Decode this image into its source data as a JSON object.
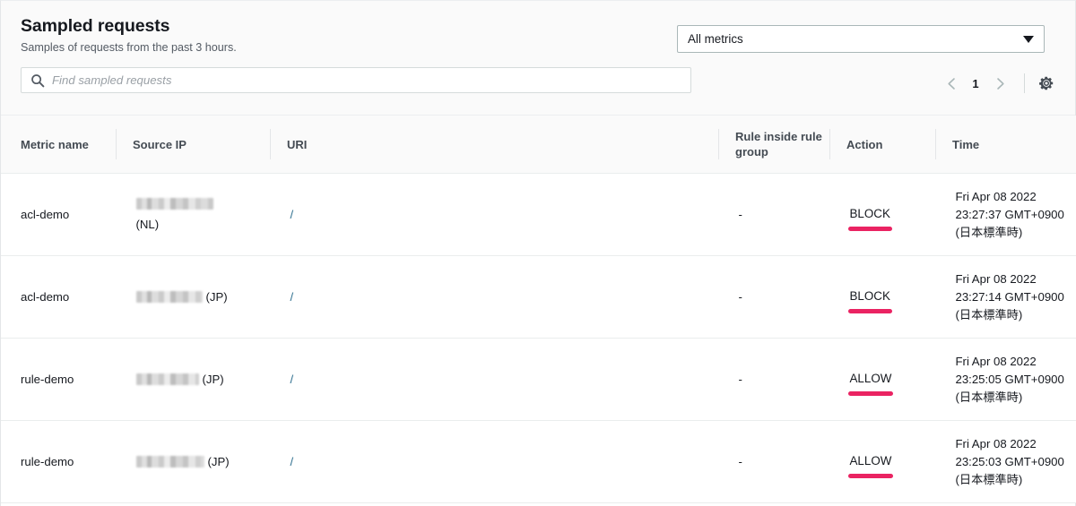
{
  "header": {
    "title": "Sampled requests",
    "subtitle": "Samples of requests from the past 3 hours."
  },
  "search": {
    "placeholder": "Find sampled requests",
    "value": "",
    "icon": "search-icon"
  },
  "metric_filter": {
    "selected": "All metrics",
    "icon": "chevron-down-icon"
  },
  "pagination": {
    "prev_icon": "chevron-left-icon",
    "next_icon": "chevron-right-icon",
    "current_page": "1"
  },
  "settings": {
    "icon": "gear-icon"
  },
  "table": {
    "columns": [
      {
        "label": "Metric name"
      },
      {
        "label": "Source IP"
      },
      {
        "label": "URI"
      },
      {
        "label": "Rule inside rule group"
      },
      {
        "label": "Action"
      },
      {
        "label": "Time"
      }
    ],
    "rows": [
      {
        "metric_name": "acl-demo",
        "source_ip_redacted": true,
        "source_ip_country": "(NL)",
        "source_ip_country_on_new_line": true,
        "uri": "/",
        "rule_inside_rule_group": "-",
        "action": "BLOCK",
        "time": "Fri Apr 08 2022 23:27:37 GMT+0900 (日本標準時)"
      },
      {
        "metric_name": "acl-demo",
        "source_ip_redacted": true,
        "source_ip_country": "(JP)",
        "source_ip_country_on_new_line": false,
        "uri": "/",
        "rule_inside_rule_group": "-",
        "action": "BLOCK",
        "time": "Fri Apr 08 2022 23:27:14 GMT+0900 (日本標準時)"
      },
      {
        "metric_name": "rule-demo",
        "source_ip_redacted": true,
        "source_ip_country": "(JP)",
        "source_ip_country_on_new_line": false,
        "uri": "/",
        "rule_inside_rule_group": "-",
        "action": "ALLOW",
        "time": "Fri Apr 08 2022 23:25:05 GMT+0900 (日本標準時)"
      },
      {
        "metric_name": "rule-demo",
        "source_ip_redacted": true,
        "source_ip_country": "(JP)",
        "source_ip_country_on_new_line": false,
        "uri": "/",
        "rule_inside_rule_group": "-",
        "action": "ALLOW",
        "time": "Fri Apr 08 2022 23:25:03 GMT+0900 (日本標準時)"
      }
    ]
  },
  "colors": {
    "highlight_underline": "#ea2362",
    "link": "#2d6e8e",
    "header_background": "#fafafa",
    "text": "#16191f"
  }
}
